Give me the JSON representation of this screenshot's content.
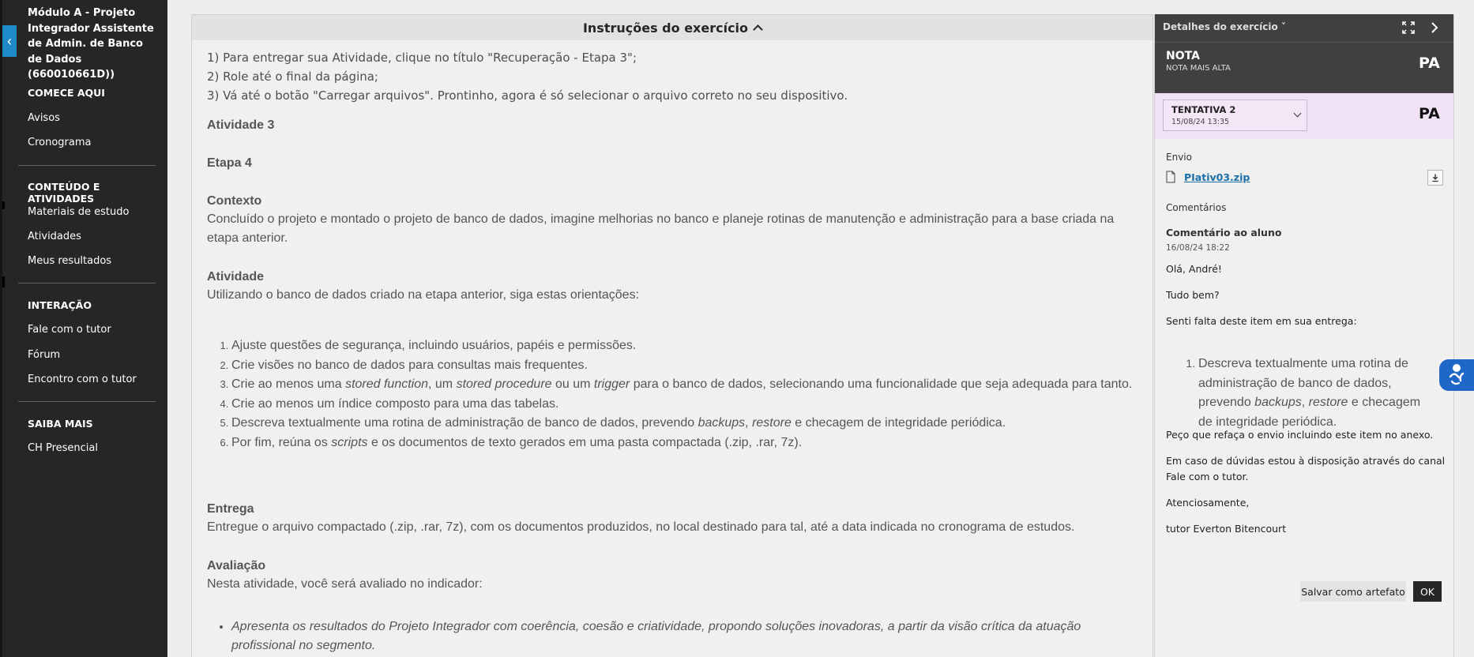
{
  "sidebar": {
    "course_title": "Módulo A - Projeto Integrador Assistente de Admin. de Banco de Dados (660010661D))",
    "sections": [
      {
        "heading": "COMECE AQUI",
        "items": [
          "Avisos",
          "Cronograma"
        ]
      },
      {
        "heading": "CONTEÚDO E ATIVIDADES",
        "items": [
          "Materiais de estudo",
          "Atividades",
          "Meus resultados"
        ]
      },
      {
        "heading": "INTERAÇÃO",
        "items": [
          "Fale com o tutor",
          "Fórum",
          "Encontro com o tutor"
        ]
      },
      {
        "heading": "SAIBA MAIS",
        "items": [
          "CH Presencial"
        ]
      }
    ]
  },
  "instructions": {
    "header": "Instruções do exercício",
    "steps": [
      "1) Para entregar sua Atividade, clique no título \"Recuperação - Etapa 3\";",
      "2) Role até o final da página;",
      "3) Vá até o botão \"Carregar arquivos\". Prontinho, agora é só selecionar o arquivo correto no seu dispositivo."
    ],
    "activity_heading": "Atividade 3",
    "stage_heading": "Etapa 4",
    "context_heading": "Contexto",
    "context_text": "Concluído o projeto e montado o projeto de banco de dados, imagine melhorias no banco e planeje rotinas de manutenção e administração para a base criada na etapa anterior.",
    "activity_sub_heading": "Atividade",
    "activity_text": "Utilizando o banco de dados criado na etapa anterior, siga estas orientações:",
    "tasks": {
      "t1": "Ajuste questões de segurança, incluindo usuários, papéis e permissões.",
      "t2": "Crie visões no banco de dados para consultas mais frequentes.",
      "t3_a": "Crie ao menos uma ",
      "t3_b": "stored function",
      "t3_c": ", um ",
      "t3_d": "stored procedure",
      "t3_e": " ou um ",
      "t3_f": "trigger",
      "t3_g": " para o banco de dados, selecionando uma funcionalidade que seja adequada para tanto.",
      "t4": "Crie ao menos um índice composto para uma das tabelas.",
      "t5_a": "Descreva textualmente uma rotina de administração de banco de dados, prevendo ",
      "t5_b": "backups",
      "t5_c": ", ",
      "t5_d": "restore",
      "t5_e": " e checagem de integridade periódica.",
      "t6_a": "Por fim, reúna os ",
      "t6_b": "scripts",
      "t6_c": " e os documentos de texto gerados em uma pasta compactada (.zip, .rar, 7z)."
    },
    "delivery_heading": "Entrega",
    "delivery_text": "Entregue o arquivo compactado (.zip, .rar, 7z), com os documentos produzidos, no local destinado para tal, até a data indicada no cronograma de estudos.",
    "evaluation_heading": "Avaliação",
    "evaluation_text": "Nesta atividade, você será avaliado no indicador:",
    "criterion": "Apresenta os resultados do Projeto Integrador com coerência, coesão e criatividade, propondo soluções inovadoras, a partir da visão crítica da atuação profissional no segmento."
  },
  "details": {
    "title": "Detalhes do exercício",
    "grade_label": "NOTA",
    "grade_sub": "NOTA MAIS ALTA",
    "grade_value": "PA",
    "attempt_label": "TENTATIVA 2",
    "attempt_date": "15/08/24 13:35",
    "attempt_value": "PA",
    "submission_label": "Envio",
    "file_name": "PIativ03.zip",
    "comments_label": "Comentários",
    "comment_author": "Comentário ao aluno",
    "comment_date": "16/08/24 18:22",
    "comment_greeting": "Olá, André!",
    "comment_line2": "Tudo bem?",
    "comment_line3": "Senti falta deste item em sua entrega:",
    "comment_item_a": "Descreva textualmente uma rotina de administração de banco de dados, prevendo ",
    "comment_item_b": "backups",
    "comment_item_c": ", ",
    "comment_item_d": "restore",
    "comment_item_e": " e checagem de integridade periódica.",
    "comment_line4": "Peço que refaça o envio incluindo este item no anexo.",
    "comment_line5": "Em caso de dúvidas estou à disposição através do canal Fale com o tutor.",
    "comment_line6": "Atenciosamente,",
    "comment_line7": "tutor Everton Bitencourt",
    "save_button": "Salvar como artefato",
    "ok_button": "OK"
  },
  "colors": {
    "sidebar_bg": "#262626",
    "accent_blue": "#1e8ac7",
    "attempt_bg": "#f1e1f5",
    "link": "#1b6fa8"
  }
}
